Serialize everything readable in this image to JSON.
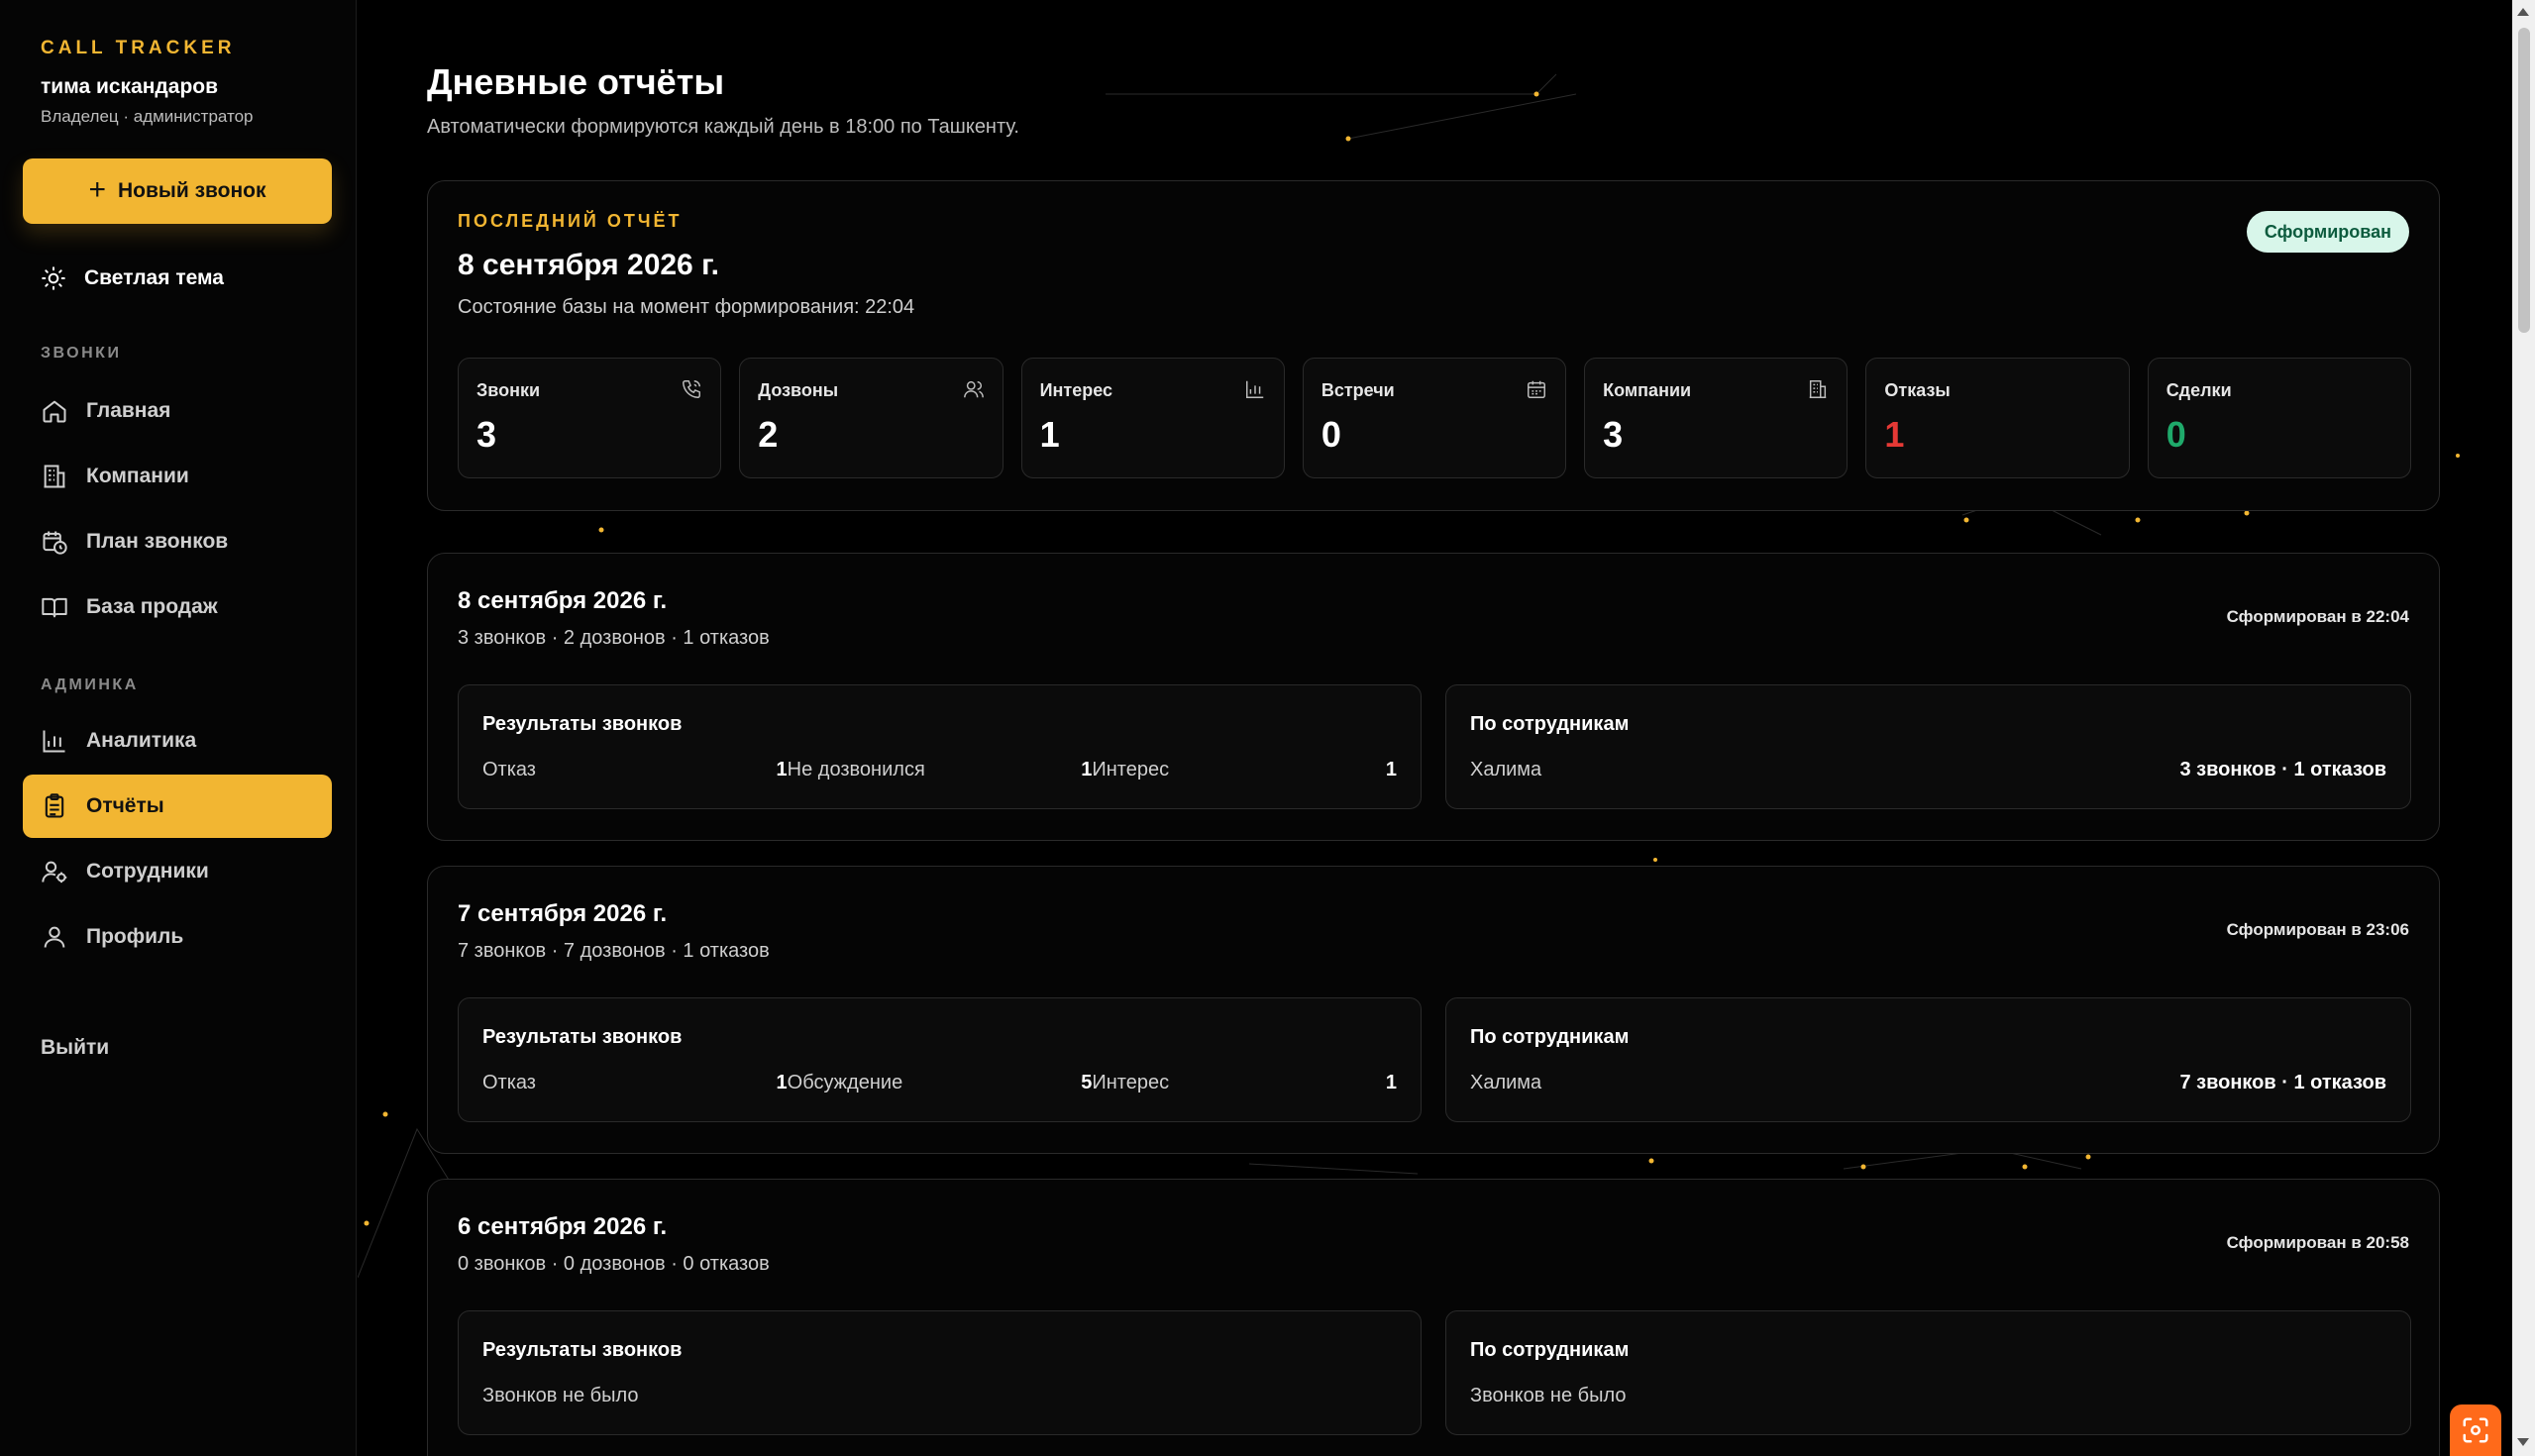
{
  "sidebar": {
    "brand": "CALL TRACKER",
    "user_name": "тима искандаров",
    "user_role": "Владелец · администратор",
    "new_call": "Новый звонок",
    "theme_toggle": "Светлая тема",
    "sections": {
      "calls": "ЗВОНКИ",
      "admin": "АДМИНКА"
    },
    "items": [
      {
        "label": "Главная",
        "icon": "home-icon"
      },
      {
        "label": "Компании",
        "icon": "building-icon"
      },
      {
        "label": "План звонков",
        "icon": "calendar-clock-icon"
      },
      {
        "label": "База продаж",
        "icon": "book-icon"
      },
      {
        "label": "Аналитика",
        "icon": "bar-chart-icon"
      },
      {
        "label": "Отчёты",
        "icon": "clipboard-icon",
        "active": true
      },
      {
        "label": "Сотрудники",
        "icon": "user-gear-icon"
      },
      {
        "label": "Профиль",
        "icon": "user-icon"
      }
    ],
    "logout": "Выйти"
  },
  "colors": {
    "accent": "#f2b632",
    "danger": "#e53935",
    "success": "#1faa6b",
    "badge_bg": "#d8f6ea"
  },
  "header": {
    "title": "Дневные отчёты",
    "subtitle": "Автоматически формируются каждый день в 18:00 по Ташкенту."
  },
  "latest": {
    "label": "ПОСЛЕДНИЙ ОТЧЁТ",
    "date": "8 сентября 2026 г.",
    "subtitle": "Состояние базы на момент формирования: 22:04",
    "badge": "Сформирован",
    "stats": [
      {
        "label": "Звонки",
        "value": "3",
        "icon": "phone-icon"
      },
      {
        "label": "Дозвоны",
        "value": "2",
        "icon": "users-icon"
      },
      {
        "label": "Интерес",
        "value": "1",
        "icon": "bar-chart-icon"
      },
      {
        "label": "Встречи",
        "value": "0",
        "icon": "calendar-icon"
      },
      {
        "label": "Компании",
        "value": "3",
        "icon": "building-icon"
      },
      {
        "label": "Отказы",
        "value": "1",
        "icon": ""
      },
      {
        "label": "Сделки",
        "value": "0",
        "icon": ""
      }
    ]
  },
  "reports": [
    {
      "date": "8 сентября 2026 г.",
      "summary": "3 звонков · 2 дозвонов · 1 отказов",
      "generated": "Сформирован в 22:04",
      "results_title": "Результаты звонков",
      "results": [
        {
          "label": "Отказ",
          "value": "1"
        },
        {
          "label": "Не дозвонился",
          "value": "1"
        },
        {
          "label": "Интерес",
          "value": "1"
        }
      ],
      "staff_title": "По сотрудникам",
      "staff_name": "Халима",
      "staff_sum": "3 звонков · 1 отказов"
    },
    {
      "date": "7 сентября 2026 г.",
      "summary": "7 звонков · 7 дозвонов · 1 отказов",
      "generated": "Сформирован в 23:06",
      "results_title": "Результаты звонков",
      "results": [
        {
          "label": "Отказ",
          "value": "1"
        },
        {
          "label": "Обсуждение",
          "value": "5"
        },
        {
          "label": "Интерес",
          "value": "1"
        }
      ],
      "staff_title": "По сотрудникам",
      "staff_name": "Халима",
      "staff_sum": "7 звонков · 1 отказов"
    },
    {
      "date": "6 сентября 2026 г.",
      "summary": "0 звонков · 0 дозвонов · 0 отказов",
      "generated": "Сформирован в 20:58",
      "results_title": "Результаты звонков",
      "results_empty": "Звонков не было",
      "staff_title": "По сотрудникам",
      "staff_empty": "Звонков не было"
    }
  ]
}
